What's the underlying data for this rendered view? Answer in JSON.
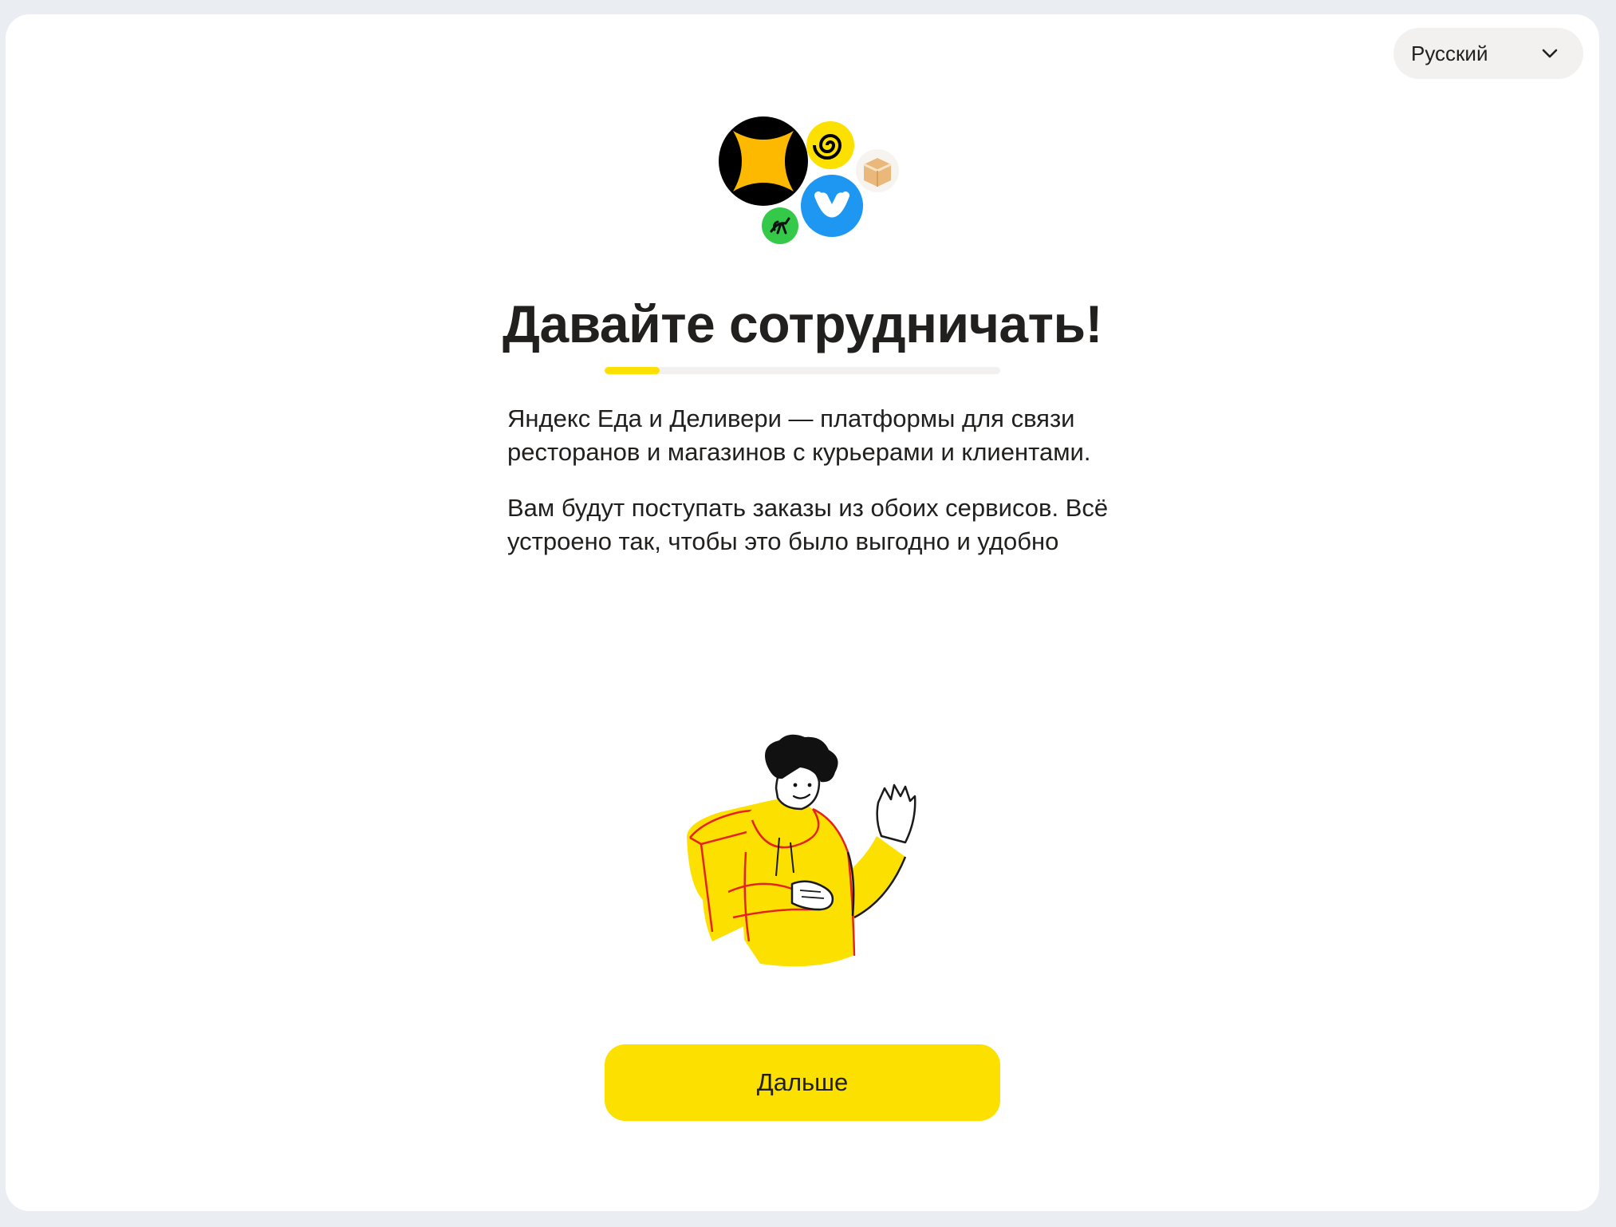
{
  "language_select": {
    "value": "Русский",
    "icon": "chevron-down-icon"
  },
  "logos": [
    "yandex-eda-logo",
    "kinopoisk-spiral-logo",
    "box-logo",
    "delivery-heart-logo",
    "ostrich-logo"
  ],
  "title": "Давайте сотрудничать!",
  "progress": {
    "fraction": 0.14,
    "color": "#fce000"
  },
  "intro": {
    "paragraph_1": "Яндекс Еда и Деливери — платформы для связи ресторанов и магазинов с курьерами и клиентами.",
    "paragraph_2": "Вам будут поступать заказы из обоих сервисов. Всё устроено так, чтобы это было выгодно и удобно"
  },
  "next_button": {
    "label": "Дальше",
    "color": "#fce000"
  }
}
